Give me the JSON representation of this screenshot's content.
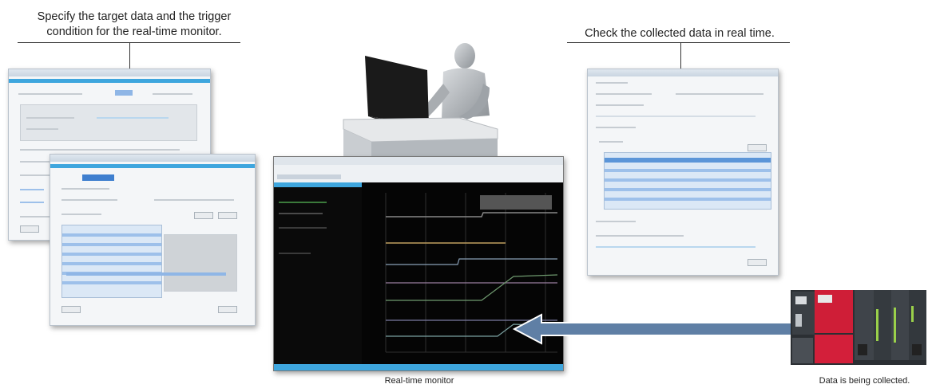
{
  "captions": {
    "left": "Specify the target data and the trigger condition for the real-time monitor.",
    "right": "Check the collected data in real time.",
    "center": "Real-time monitor",
    "plc": "Data is being collected."
  },
  "colors": {
    "arrow": "#5f7fa5",
    "window_accent": "#3ea6de",
    "monitor_bg": "#111111",
    "plc_red": "#d31f3a"
  }
}
